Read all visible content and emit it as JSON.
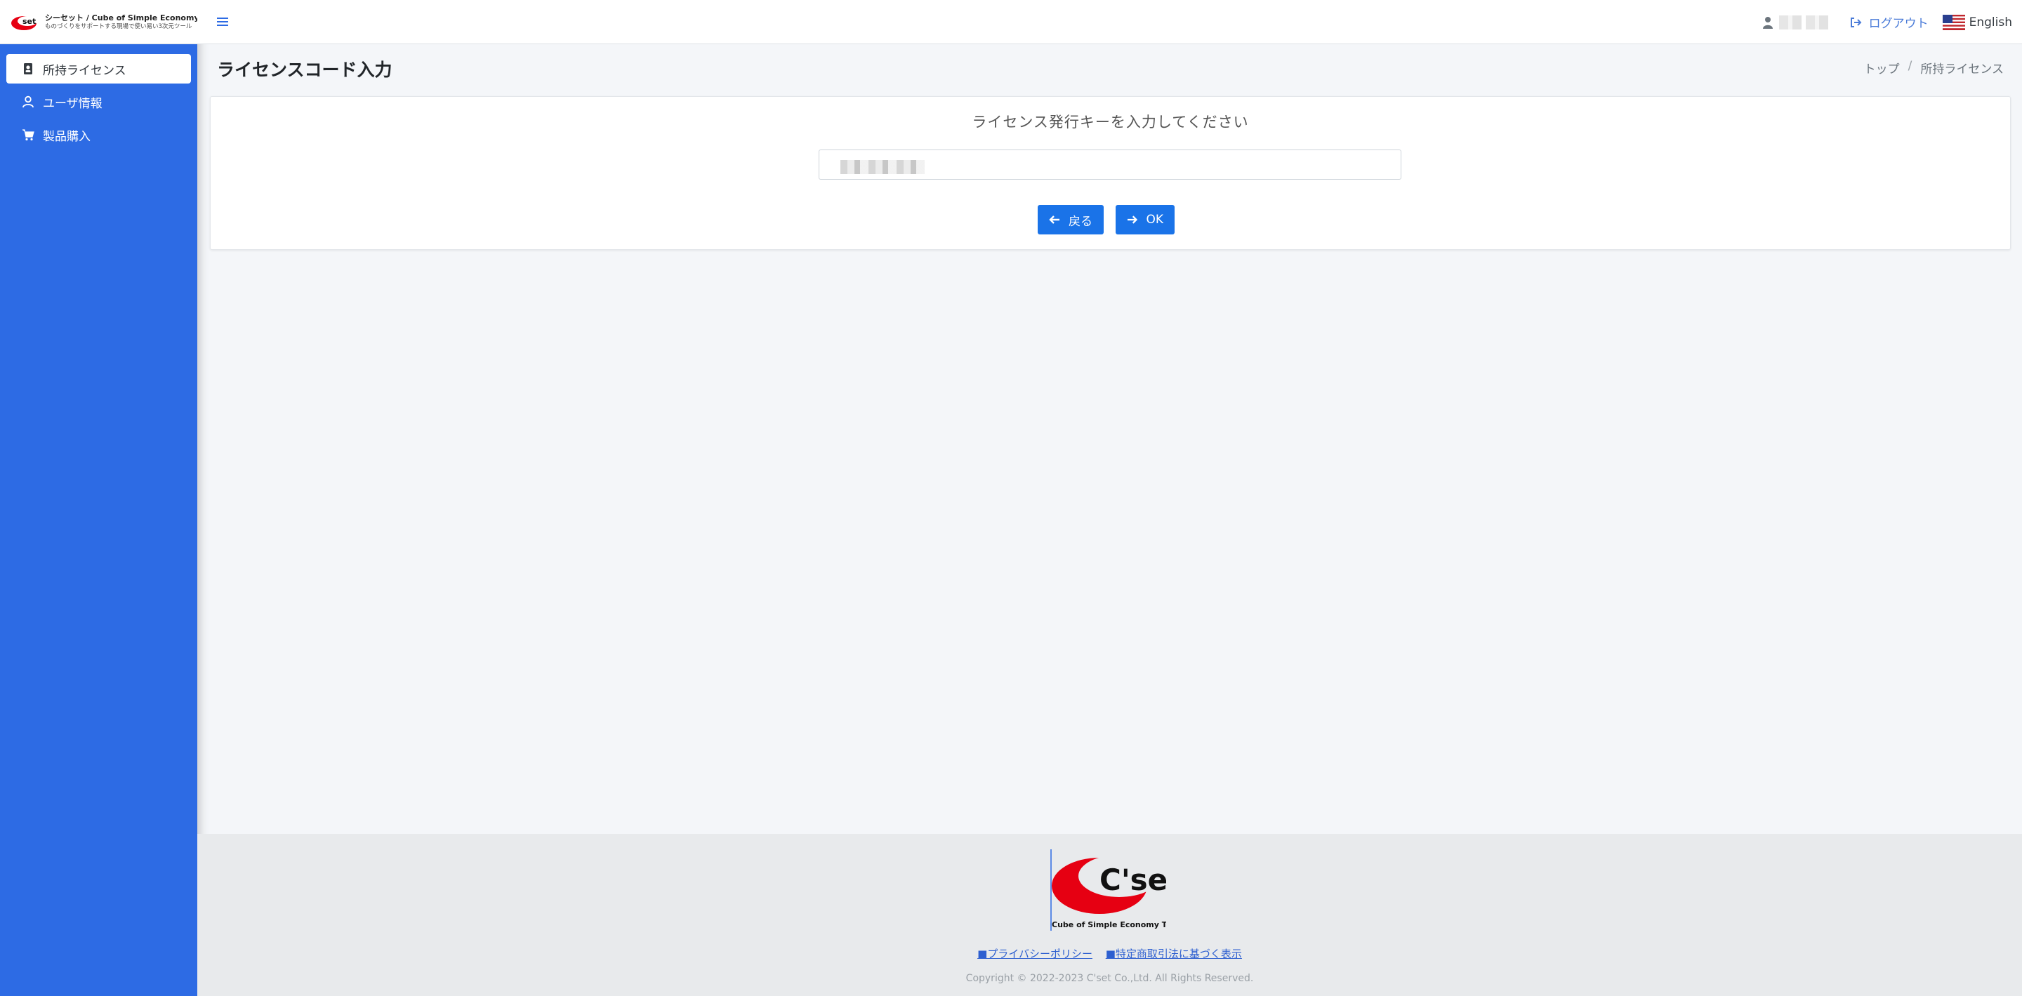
{
  "brand": {
    "title": "シーセット / Cube of Simple Economy Tool",
    "subtitle": "ものづくりをサポートする現場で使い易い3次元ツール",
    "logo_text": "C'set"
  },
  "sidebar": {
    "items": [
      {
        "label": "所持ライセンス",
        "icon": "id-badge-icon",
        "active": true
      },
      {
        "label": "ユーザ情報",
        "icon": "user-icon",
        "active": false
      },
      {
        "label": "製品購入",
        "icon": "cart-icon",
        "active": false
      }
    ]
  },
  "header": {
    "logout_label": "ログアウト",
    "language_label": "English"
  },
  "content": {
    "page_title": "ライセンスコード入力",
    "breadcrumb": [
      "トップ",
      "所持ライセンス"
    ],
    "prompt": "ライセンス発行キーを入力してください",
    "key_value": "",
    "back_label": "戻る",
    "ok_label": "OK"
  },
  "footer": {
    "logo_text": "C'set",
    "logo_caption": "Cube of Simple Economy Tool",
    "links": [
      "■プライバシーポリシー",
      "■特定商取引法に基づく表示"
    ],
    "copyright": "Copyright © 2022-2023 C'set Co.,Ltd. All Rights Reserved."
  },
  "colors": {
    "sidebar": "#2d6be4",
    "primary_button": "#1a73e8",
    "logo_red": "#e60012"
  }
}
